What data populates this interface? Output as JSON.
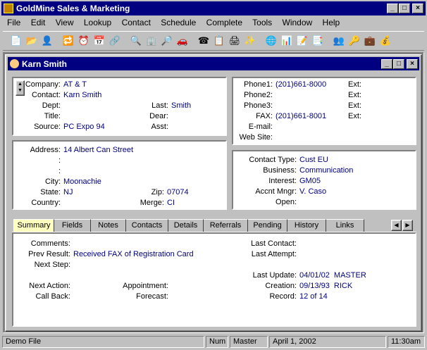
{
  "app": {
    "title": "GoldMine Sales & Marketing"
  },
  "menu": [
    "File",
    "Edit",
    "View",
    "Lookup",
    "Contact",
    "Schedule",
    "Complete",
    "Tools",
    "Window",
    "Help"
  ],
  "toolbar": [
    "new-record-icon",
    "open-folder-icon",
    "user-icon",
    "schedule-icon",
    "clock-icon",
    "calendar-icon",
    "org-chart-icon",
    "find-icon",
    "buildings-icon",
    "search-record-icon",
    "car-icon",
    "phone-icon",
    "copy-icon",
    "print-icon",
    "magic-wand-icon",
    "globe-icon",
    "report-icon",
    "notepad-icon",
    "document-icon",
    "users-icon",
    "key-icon",
    "sales-icon",
    "dollar-icon"
  ],
  "doc": {
    "title": "Karn Smith"
  },
  "contact": {
    "company_label": "Company:",
    "company": "AT & T",
    "contact_label": "Contact:",
    "contact": "Karn Smith",
    "dept_label": "Dept:",
    "last_label": "Last:",
    "last": "Smith",
    "title_label": "Title:",
    "dear_label": "Dear:",
    "source_label": "Source:",
    "source": "PC Expo 94",
    "asst_label": "Asst:"
  },
  "phones": {
    "p1_label": "Phone1:",
    "p1": "(201)661-8000",
    "p2_label": "Phone2:",
    "p3_label": "Phone3:",
    "fax_label": "FAX:",
    "fax": "(201)661-8001",
    "ext_label": "Ext:",
    "email_label": "E-mail:",
    "web_label": "Web Site:"
  },
  "address": {
    "address_label": "Address:",
    "address": "14 Albert Can Street",
    "colon": ":",
    "city_label": "City:",
    "city": "Moonachie",
    "state_label": "State:",
    "state": "NJ",
    "zip_label": "Zip:",
    "zip": "07074",
    "country_label": "Country:",
    "merge_label": "Merge:",
    "merge": "CI"
  },
  "details": {
    "type_label": "Contact Type:",
    "type": "Cust EU",
    "business_label": "Business:",
    "business": "Communication",
    "interest_label": "Interest:",
    "interest": "GM05",
    "mngr_label": "Accnt Mngr:",
    "mngr": "V. Caso",
    "open_label": "Open:"
  },
  "tabs": [
    "Summary",
    "Fields",
    "Notes",
    "Contacts",
    "Details",
    "Referrals",
    "Pending",
    "History",
    "Links"
  ],
  "summary": {
    "comments_label": "Comments:",
    "prev_label": "Prev Result:",
    "prev": "Received FAX of Registration Card",
    "next_step_label": "Next Step:",
    "next_action_label": "Next Action:",
    "appointment_label": "Appointment:",
    "callback_label": "Call Back:",
    "forecast_label": "Forecast:",
    "last_contact_label": "Last Contact:",
    "last_attempt_label": "Last Attempt:",
    "last_update_label": "Last Update:",
    "last_update": "04/01/02  MASTER",
    "creation_label": "Creation:",
    "creation": "09/13/93  RICK",
    "record_label": "Record:",
    "record": "12 of 14"
  },
  "status": {
    "file": "Demo File",
    "num": "Num",
    "user": "Master",
    "date": "April 1, 2002",
    "time": "11:30am"
  },
  "colors": {
    "title": "#000080",
    "value": "#000080",
    "face": "#c0c0c0",
    "tab_selected": "#ffffc0"
  }
}
